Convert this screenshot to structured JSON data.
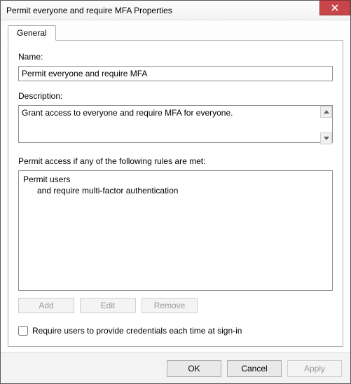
{
  "window": {
    "title": "Permit everyone and require MFA Properties"
  },
  "tabs": {
    "general": "General"
  },
  "general": {
    "name_label": "Name:",
    "name_value": "Permit everyone and require MFA",
    "description_label": "Description:",
    "description_value": "Grant access to everyone and require MFA for everyone.",
    "rules_label": "Permit access if any of the following rules are met:",
    "rules_text": "Permit users\n      and require multi-factor authentication",
    "buttons": {
      "add": "Add",
      "edit": "Edit",
      "remove": "Remove"
    },
    "require_creds_label": "Require users to provide credentials each time at sign-in",
    "require_creds_checked": false
  },
  "footer": {
    "ok": "OK",
    "cancel": "Cancel",
    "apply": "Apply"
  }
}
